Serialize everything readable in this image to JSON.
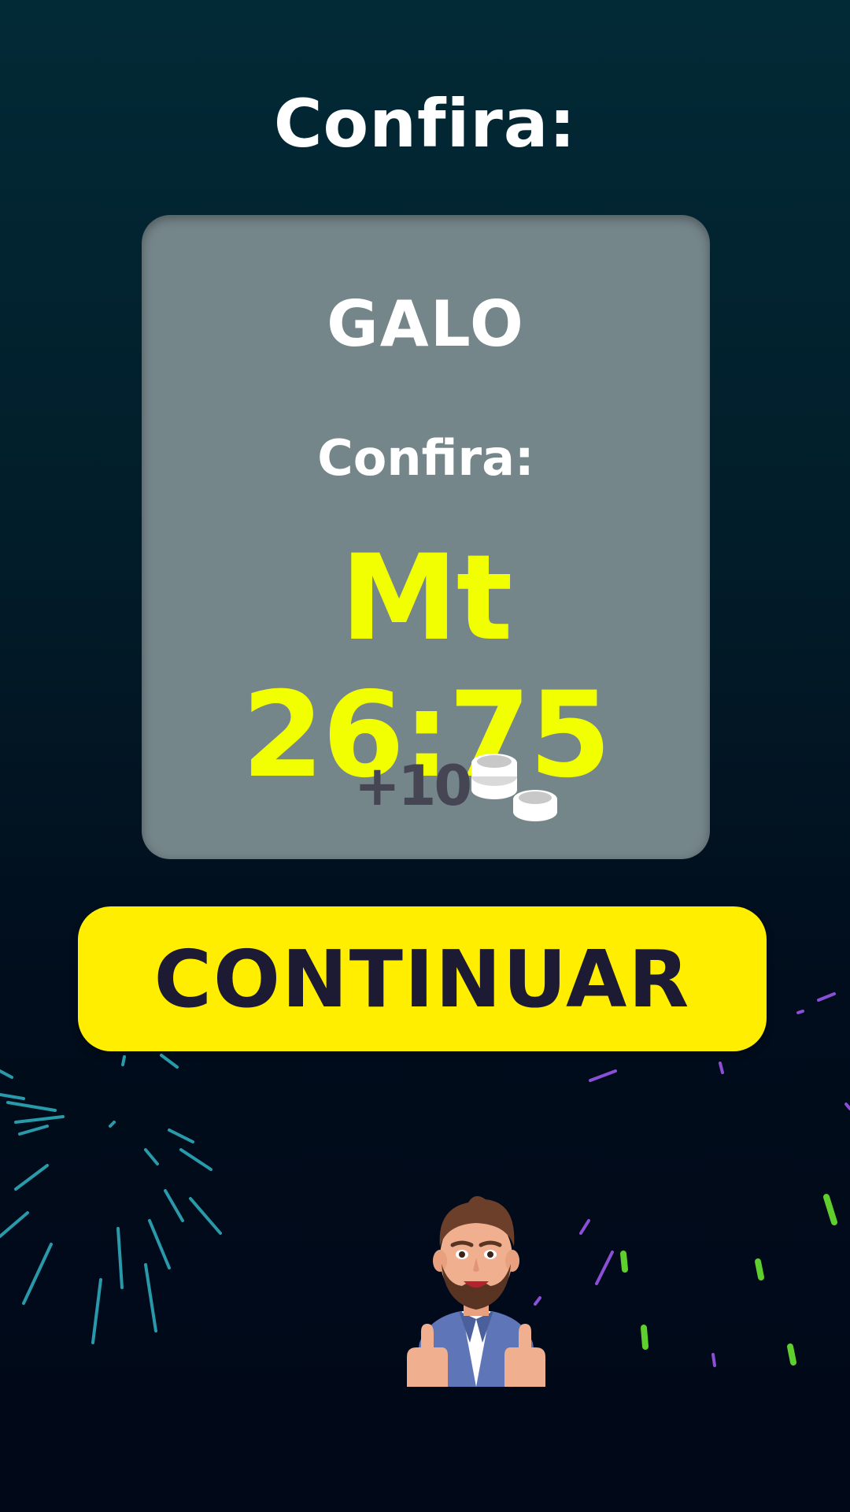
{
  "header": {
    "title": "Confira:"
  },
  "card": {
    "title": "GALO",
    "subtitle": "Confira:",
    "amount": "Mt 26:75",
    "reward_text": "+10",
    "reward_icon": "coins-icon"
  },
  "actions": {
    "continue_label": "CONTINUAR"
  },
  "decorations": {
    "fireworks": "fireworks-burst",
    "character": "man-thumbs-up-illustration"
  },
  "colors": {
    "background_top": "#022a36",
    "background_bottom": "#010818",
    "card": "#75868b",
    "amount": "#f2ff00",
    "button": "#ffee00",
    "button_text": "#1d1a33",
    "reward_text": "#454554"
  }
}
